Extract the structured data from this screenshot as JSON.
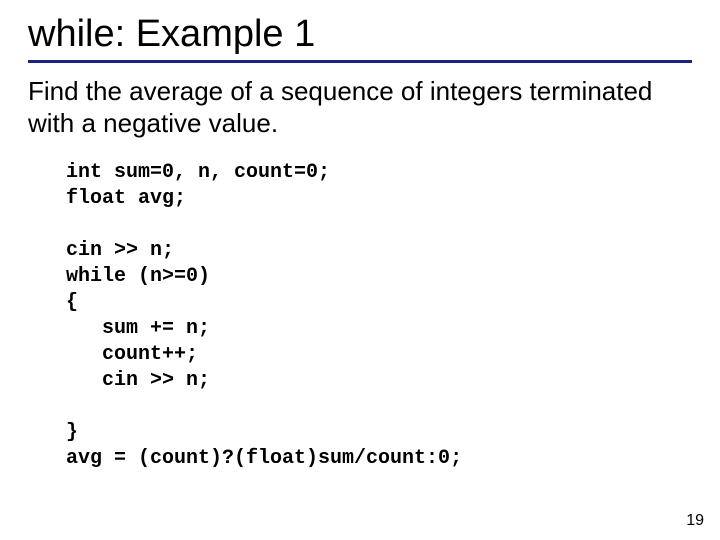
{
  "title": "while: Example 1",
  "description": "Find the average of a sequence of integers terminated with a negative value.",
  "code": {
    "l1": "int sum=0, n, count=0;",
    "l2": "float avg;",
    "l3": "",
    "l4": "cin >> n;",
    "l5": "while (n>=0)",
    "l6": "{",
    "l7": "   sum += n;",
    "l8": "   count++;",
    "l9": "   cin >> n;",
    "l10": "",
    "l11": "}",
    "l12": "avg = (count)?(float)sum/count:0;"
  },
  "page_number": "19"
}
